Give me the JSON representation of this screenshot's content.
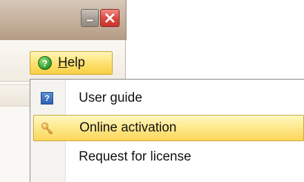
{
  "window": {
    "minimize_glyph": "–",
    "close_glyph": "✕"
  },
  "menubar": {
    "help": {
      "mnemonic": "H",
      "rest": "elp",
      "icon": "help-icon"
    }
  },
  "dropdown": {
    "items": [
      {
        "label": "User guide",
        "icon": "user-guide-icon"
      },
      {
        "label": "Online activation",
        "icon": "key-icon",
        "highlighted": true
      },
      {
        "label": "Request for license",
        "icon": ""
      }
    ]
  },
  "colors": {
    "highlight": "#fde478",
    "close_button": "#dd4b43"
  }
}
